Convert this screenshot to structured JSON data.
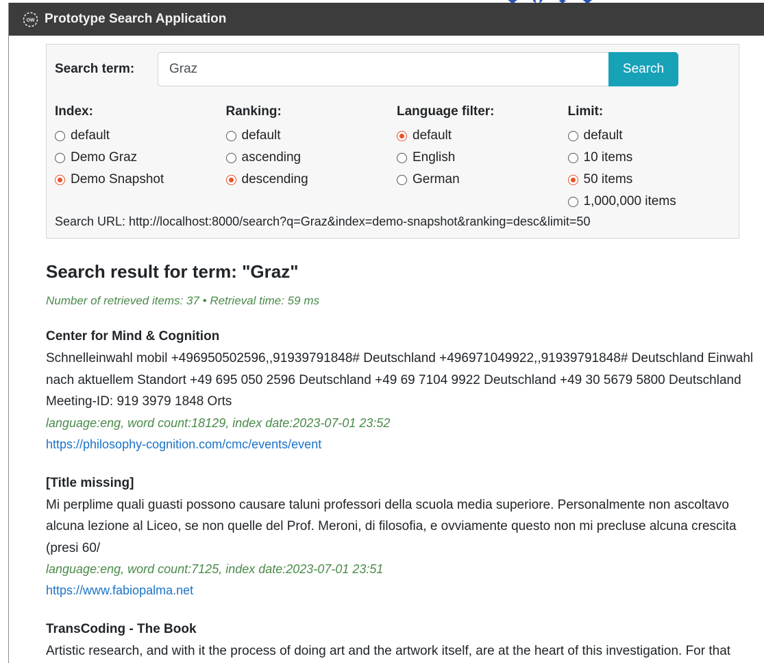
{
  "app": {
    "title": "Prototype Search Application",
    "logo_icon": "gear-logo-icon"
  },
  "search": {
    "label": "Search term:",
    "value": "Graz",
    "button_label": "Search"
  },
  "options": {
    "index": {
      "label": "Index:",
      "items": [
        "default",
        "Demo Graz",
        "Demo Snapshot"
      ],
      "selected": 2
    },
    "ranking": {
      "label": "Ranking:",
      "items": [
        "default",
        "ascending",
        "descending"
      ],
      "selected": 2
    },
    "language": {
      "label": "Language filter:",
      "items": [
        "default",
        "English",
        "German"
      ],
      "selected": 0
    },
    "limit": {
      "label": "Limit:",
      "items": [
        "default",
        "10 items",
        "50 items",
        "1,000,000 items"
      ],
      "selected": 2
    }
  },
  "search_url": "Search URL: http://localhost:8000/search?q=Graz&index=demo-snapshot&ranking=desc&limit=50",
  "results": {
    "heading": "Search result for term: \"Graz\"",
    "meta": "Number of retrieved items: 37 • Retrieval time: 59 ms",
    "items": [
      {
        "title": "Center for Mind & Cognition",
        "snippet": "Schnelleinwahl mobil +496950502596,,91939791848# Deutschland +496971049922,,91939791848# Deutschland Einwahl nach aktuellem Standort +49 695 050 2596 Deutschland +49 69 7104 9922 Deutschland +49 30 5679 5800 Deutschland Meeting-ID: 919 3979 1848 Orts",
        "meta": "language:eng, word count:18129, index date:2023-07-01 23:52",
        "url": "https://philosophy-cognition.com/cmc/events/event"
      },
      {
        "title": "[Title missing]",
        "snippet": "Mi perplime quali guasti possono causare taluni professori della scuola media superiore. Personalmente non ascoltavo alcuna lezione al Liceo, se non quelle del Prof. Meroni, di filosofia, e ovviamente questo non mi precluse alcuna crescita (presi 60/",
        "meta": "language:eng, word count:7125, index date:2023-07-01 23:51",
        "url": "https://www.fabiopalma.net"
      },
      {
        "title": "TransCoding - The Book",
        "snippet": "Artistic research, and with it the process of doing art and the artwork itself, are at the heart of this investigation. For that reason, I provide – as an augmented way of reading – this complementary website to",
        "meta": "",
        "url": ""
      }
    ]
  },
  "colors": {
    "titlebar": "#3c3c3c",
    "accent": "#17a2b8",
    "radio_selected": "#e8532b",
    "meta_green": "#4a8a4a",
    "link": "#1a73c7"
  }
}
